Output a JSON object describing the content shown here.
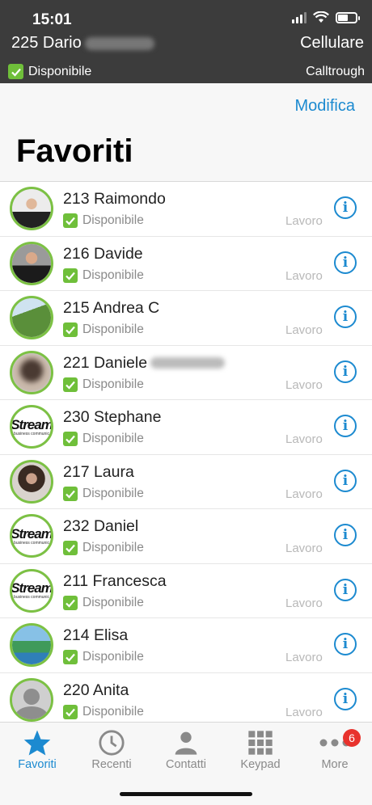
{
  "status_bar": {
    "time": "15:01"
  },
  "account": {
    "name": "225 Dario",
    "device": "Cellulare",
    "status": "Disponibile",
    "mode": "Calltrough"
  },
  "header": {
    "edit_label": "Modifica",
    "title": "Favoriti"
  },
  "contacts": [
    {
      "name": "213 Raimondo",
      "status": "Disponibile",
      "label": "Lavoro"
    },
    {
      "name": "216 Davide",
      "status": "Disponibile",
      "label": "Lavoro"
    },
    {
      "name": "215 Andrea C",
      "status": "Disponibile",
      "label": "Lavoro"
    },
    {
      "name": "221 Daniele",
      "status": "Disponibile",
      "label": "Lavoro"
    },
    {
      "name": "230 Stephane",
      "status": "Disponibile",
      "label": "Lavoro"
    },
    {
      "name": "217 Laura",
      "status": "Disponibile",
      "label": "Lavoro"
    },
    {
      "name": "232 Daniel",
      "status": "Disponibile",
      "label": "Lavoro"
    },
    {
      "name": "211 Francesca",
      "status": "Disponibile",
      "label": "Lavoro"
    },
    {
      "name": "214 Elisa",
      "status": "Disponibile",
      "label": "Lavoro"
    },
    {
      "name": "220 Anita",
      "status": "Disponibile",
      "label": "Lavoro"
    }
  ],
  "avatar_logo_text": "Stream",
  "avatar_logo_subtext": "business communic",
  "info_glyph": "i",
  "tabs": [
    {
      "label": "Favoriti",
      "icon": "star-icon",
      "active": true
    },
    {
      "label": "Recenti",
      "icon": "clock-icon",
      "active": false
    },
    {
      "label": "Contatti",
      "icon": "person-icon",
      "active": false
    },
    {
      "label": "Keypad",
      "icon": "keypad-icon",
      "active": false
    },
    {
      "label": "More",
      "icon": "more-icon",
      "active": false,
      "badge": "6"
    }
  ],
  "colors": {
    "accent": "#1c8ad0",
    "available": "#6fbf3a",
    "top_bar": "#3c3c3c",
    "badge": "#e8322d"
  }
}
